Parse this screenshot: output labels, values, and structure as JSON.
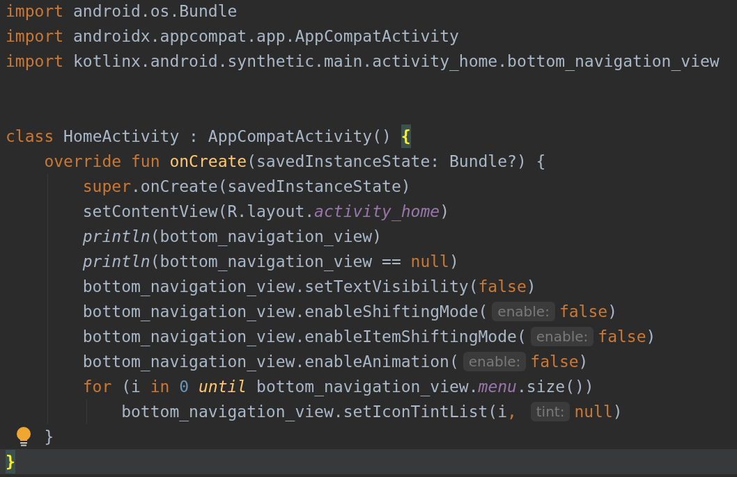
{
  "editor": {
    "lines": [
      {
        "current": false,
        "lightbulb": false,
        "tokens": [
          {
            "kind": "kw",
            "text": "import"
          },
          {
            "kind": "plain",
            "text": " android.os.Bundle"
          }
        ]
      },
      {
        "current": false,
        "lightbulb": false,
        "tokens": [
          {
            "kind": "kw",
            "text": "import"
          },
          {
            "kind": "plain",
            "text": " androidx.appcompat.app.AppCompatActivity"
          }
        ]
      },
      {
        "current": false,
        "lightbulb": false,
        "tokens": [
          {
            "kind": "kw",
            "text": "import"
          },
          {
            "kind": "plain",
            "text": " kotlinx.android.synthetic.main.activity_home.bottom_navigation_view"
          }
        ]
      },
      {
        "current": false,
        "lightbulb": false
      },
      {
        "current": false,
        "lightbulb": false
      },
      {
        "current": false,
        "lightbulb": false,
        "tokens": [
          {
            "kind": "kw",
            "text": "class"
          },
          {
            "kind": "plain",
            "text": " HomeActivity : AppCompatActivity() "
          },
          {
            "kind": "brace",
            "text": "{"
          }
        ],
        "children": [
          {
            "current": false,
            "lightbulb": false,
            "tokens": [
              {
                "kind": "kw",
                "text": "override fun "
              },
              {
                "kind": "fn",
                "text": "onCreate"
              },
              {
                "kind": "plain",
                "text": "(savedInstanceState: Bundle?) {"
              }
            ],
            "children": [
              {
                "current": false,
                "lightbulb": false,
                "tokens": [
                  {
                    "kind": "kw",
                    "text": "super"
                  },
                  {
                    "kind": "plain",
                    "text": ".onCreate(savedInstanceState)"
                  }
                ]
              },
              {
                "current": false,
                "lightbulb": false,
                "tokens": [
                  {
                    "kind": "plain",
                    "text": "setContentView(R.layout."
                  },
                  {
                    "kind": "prop",
                    "text": "activity_home"
                  },
                  {
                    "kind": "plain",
                    "text": ")"
                  }
                ]
              },
              {
                "current": false,
                "lightbulb": false,
                "tokens": [
                  {
                    "kind": "italic",
                    "text": "println"
                  },
                  {
                    "kind": "plain",
                    "text": "(bottom_navigation_view)"
                  }
                ]
              },
              {
                "current": false,
                "lightbulb": false,
                "tokens": [
                  {
                    "kind": "italic",
                    "text": "println"
                  },
                  {
                    "kind": "plain",
                    "text": "(bottom_navigation_view == "
                  },
                  {
                    "kind": "kw",
                    "text": "null"
                  },
                  {
                    "kind": "plain",
                    "text": ")"
                  }
                ]
              },
              {
                "current": false,
                "lightbulb": false,
                "tokens": [
                  {
                    "kind": "plain",
                    "text": "bottom_navigation_view.setTextVisibility("
                  },
                  {
                    "kind": "kw",
                    "text": "false"
                  },
                  {
                    "kind": "plain",
                    "text": ")"
                  }
                ]
              },
              {
                "current": false,
                "lightbulb": false,
                "tokens": [
                  {
                    "kind": "plain",
                    "text": "bottom_navigation_view.enableShiftingMode("
                  },
                  {
                    "kind": "hint",
                    "text": "enable:"
                  },
                  {
                    "kind": "kw",
                    "text": "false"
                  },
                  {
                    "kind": "plain",
                    "text": ")"
                  }
                ]
              },
              {
                "current": false,
                "lightbulb": false,
                "tokens": [
                  {
                    "kind": "plain",
                    "text": "bottom_navigation_view.enableItemShiftingMode("
                  },
                  {
                    "kind": "hint",
                    "text": "enable:"
                  },
                  {
                    "kind": "kw",
                    "text": "false"
                  },
                  {
                    "kind": "plain",
                    "text": ")"
                  }
                ]
              },
              {
                "current": false,
                "lightbulb": false,
                "tokens": [
                  {
                    "kind": "plain",
                    "text": "bottom_navigation_view.enableAnimation("
                  },
                  {
                    "kind": "hint",
                    "text": "enable:"
                  },
                  {
                    "kind": "kw",
                    "text": "false"
                  },
                  {
                    "kind": "plain",
                    "text": ")"
                  }
                ]
              },
              {
                "current": false,
                "lightbulb": false,
                "tokens": [
                  {
                    "kind": "kw",
                    "text": "for"
                  },
                  {
                    "kind": "plain",
                    "text": " (i "
                  },
                  {
                    "kind": "kw",
                    "text": "in "
                  },
                  {
                    "kind": "num",
                    "text": "0"
                  },
                  {
                    "kind": "infix",
                    "text": " until"
                  },
                  {
                    "kind": "plain",
                    "text": " bottom_navigation_view."
                  },
                  {
                    "kind": "prop",
                    "text": "menu"
                  },
                  {
                    "kind": "plain",
                    "text": ".size())"
                  }
                ],
                "children": [
                  {
                    "current": false,
                    "lightbulb": false,
                    "tokens": [
                      {
                        "kind": "plain",
                        "text": "bottom_navigation_view.setIconTintList(i"
                      },
                      {
                        "kind": "kw",
                        "text": ", "
                      },
                      {
                        "kind": "hint",
                        "text": "tint:"
                      },
                      {
                        "kind": "kw",
                        "text": "null"
                      },
                      {
                        "kind": "plain",
                        "text": ")"
                      }
                    ]
                  }
                ]
              }
            ]
          },
          {
            "current": false,
            "lightbulb": true,
            "tokens": [
              {
                "kind": "plain",
                "text": "}"
              }
            ]
          }
        ]
      },
      {
        "current": true,
        "lightbulb": false,
        "tokens": [
          {
            "kind": "brace",
            "text": "}"
          }
        ]
      }
    ]
  }
}
